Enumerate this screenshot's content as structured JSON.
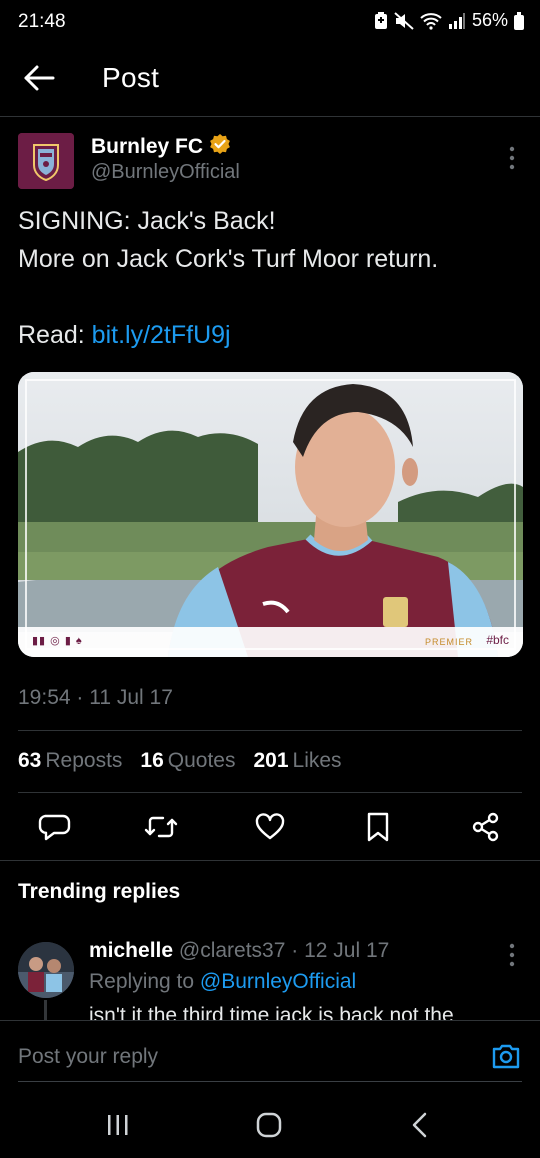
{
  "status_bar": {
    "time": "21:48",
    "battery": "56%",
    "icons": [
      "battery-saver-icon",
      "mute-icon",
      "wifi-icon",
      "signal-icon",
      "battery-icon"
    ]
  },
  "header": {
    "back_icon": "back-arrow-icon",
    "title": "Post"
  },
  "tweet": {
    "author_name": "Burnley FC",
    "verified_icon": "verified-badge-icon",
    "author_handle": "@BurnleyOfficial",
    "text_line1": "SIGNING: Jack's Back!",
    "text_line2": "More on Jack Cork's Turf Moor return.",
    "read_label": "Read: ",
    "link": "bit.ly/2tFfU9j",
    "media": {
      "hashtag": "#bfc",
      "sponsor": "PREMIER",
      "social_icons": "social-media-icons"
    },
    "timestamp": "19:54 · 11 Jul 17",
    "stats": {
      "reposts_count": "63",
      "reposts_label": "Reposts",
      "quotes_count": "16",
      "quotes_label": "Quotes",
      "likes_count": "201",
      "likes_label": "Likes"
    },
    "actions": [
      "reply-icon",
      "repost-icon",
      "like-icon",
      "bookmark-icon",
      "share-icon"
    ]
  },
  "trending": {
    "title": "Trending replies",
    "reply": {
      "name": "michelle",
      "handle_time": " @clarets37 · 12 Jul 17",
      "replying_prefix": "Replying to ",
      "replying_handle": "@BurnleyOfficial",
      "text": "isn't it the third time jack is back not the"
    }
  },
  "composer": {
    "placeholder": "Post your reply",
    "camera_icon": "camera-icon"
  },
  "nav": {
    "icons": [
      "recent-apps-icon",
      "home-icon",
      "back-icon"
    ]
  },
  "colors": {
    "background": "#000000",
    "link": "#1d9bf0",
    "muted": "#71767b",
    "claret": "#6c1d45",
    "verified": "#e8a317"
  }
}
